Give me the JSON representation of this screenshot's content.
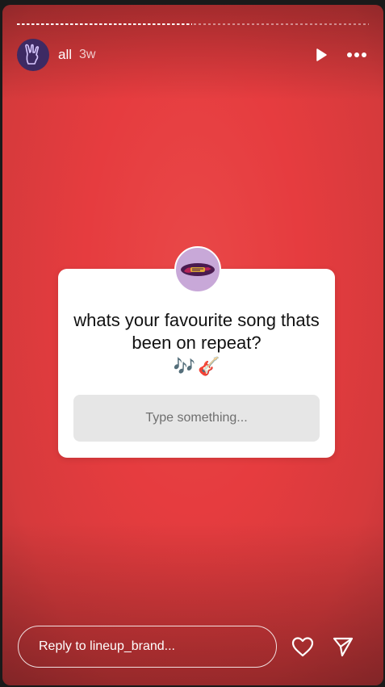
{
  "story": {
    "progress_segments": [
      {
        "state": "viewed"
      },
      {
        "state": "pending"
      }
    ]
  },
  "header": {
    "username": "all",
    "time_ago": "3w",
    "avatar_icon": "rock-hand-icon",
    "play_icon": "play-icon",
    "more_icon": "more-options-icon"
  },
  "question_sticker": {
    "avatar_icon": "lineup-logo-icon",
    "question": "whats your favourite song thats been on repeat?",
    "emojis": [
      "🎶",
      "🎸"
    ],
    "answer_placeholder": "Type something..."
  },
  "footer": {
    "reply_placeholder": "Reply to lineup_brand...",
    "like_icon": "heart-icon",
    "share_icon": "send-icon"
  },
  "colors": {
    "background": "#e63c3f",
    "card": "#ffffff",
    "answer_box": "#e6e6e6",
    "avatar_bg": "#3d2a63"
  }
}
